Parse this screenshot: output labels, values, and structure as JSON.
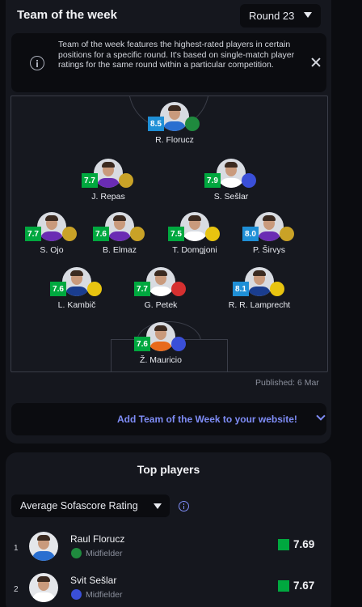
{
  "colors": {
    "rating_green": "#00a83f",
    "rating_blue": "#1f8fd6",
    "accent": "#7e8cf5"
  },
  "team_of_week": {
    "title": "Team of the week",
    "round_label": "Round 23",
    "info_text": "Team of the week features the highest-rated players in certain positions for a specific round. It's based on single-match player ratings for the same round within a particular competition.",
    "players": [
      {
        "name": "R. Florucz",
        "rating": "8.5",
        "rating_color": "#1f8fd6",
        "club_color": "#1f8a3e",
        "shirt_color": "#2a6fd0"
      },
      {
        "name": "J. Repas",
        "rating": "7.7",
        "rating_color": "#00a83f",
        "club_color": "#c9a227",
        "shirt_color": "#6a2cb3"
      },
      {
        "name": "S. Sešlar",
        "rating": "7.9",
        "rating_color": "#00a83f",
        "club_color": "#3a4fd8",
        "shirt_color": "#ffffff"
      },
      {
        "name": "S. Ojo",
        "rating": "7.7",
        "rating_color": "#00a83f",
        "club_color": "#c9a227",
        "shirt_color": "#6a2cb3"
      },
      {
        "name": "B. Elmaz",
        "rating": "7.6",
        "rating_color": "#00a83f",
        "club_color": "#c9a227",
        "shirt_color": "#6a2cb3"
      },
      {
        "name": "T. Domgjoni",
        "rating": "7.5",
        "rating_color": "#00a83f",
        "club_color": "#e8c410",
        "shirt_color": "#ffffff"
      },
      {
        "name": "P. Širvys",
        "rating": "8.0",
        "rating_color": "#1f8fd6",
        "club_color": "#c9a227",
        "shirt_color": "#6a2cb3"
      },
      {
        "name": "L. Kambič",
        "rating": "7.6",
        "rating_color": "#00a83f",
        "club_color": "#e8c410",
        "shirt_color": "#1a3d8f"
      },
      {
        "name": "G. Petek",
        "rating": "7.7",
        "rating_color": "#00a83f",
        "club_color": "#d63030",
        "shirt_color": "#ffffff"
      },
      {
        "name": "R. R. Lamprecht",
        "rating": "8.1",
        "rating_color": "#1f8fd6",
        "club_color": "#e8c410",
        "shirt_color": "#1a3d8f"
      },
      {
        "name": "Ž. Mauricio",
        "rating": "7.6",
        "rating_color": "#00a83f",
        "club_color": "#3a4fd8",
        "shirt_color": "#e86a1c"
      }
    ],
    "published": "Published: 6 Mar",
    "embed_label": "Add Team of the Week to your website!"
  },
  "top_players": {
    "title": "Top players",
    "metric_label": "Average Sofascore Rating",
    "rows": [
      {
        "rank": "1",
        "name": "Raul Florucz",
        "position": "Midfielder",
        "rating": "7.69",
        "club_color": "#1f8a3e",
        "shirt_color": "#2a6fd0"
      },
      {
        "rank": "2",
        "name": "Svit Sešlar",
        "position": "Midfielder",
        "rating": "7.67",
        "club_color": "#3a4fd8",
        "shirt_color": "#ffffff"
      }
    ]
  }
}
